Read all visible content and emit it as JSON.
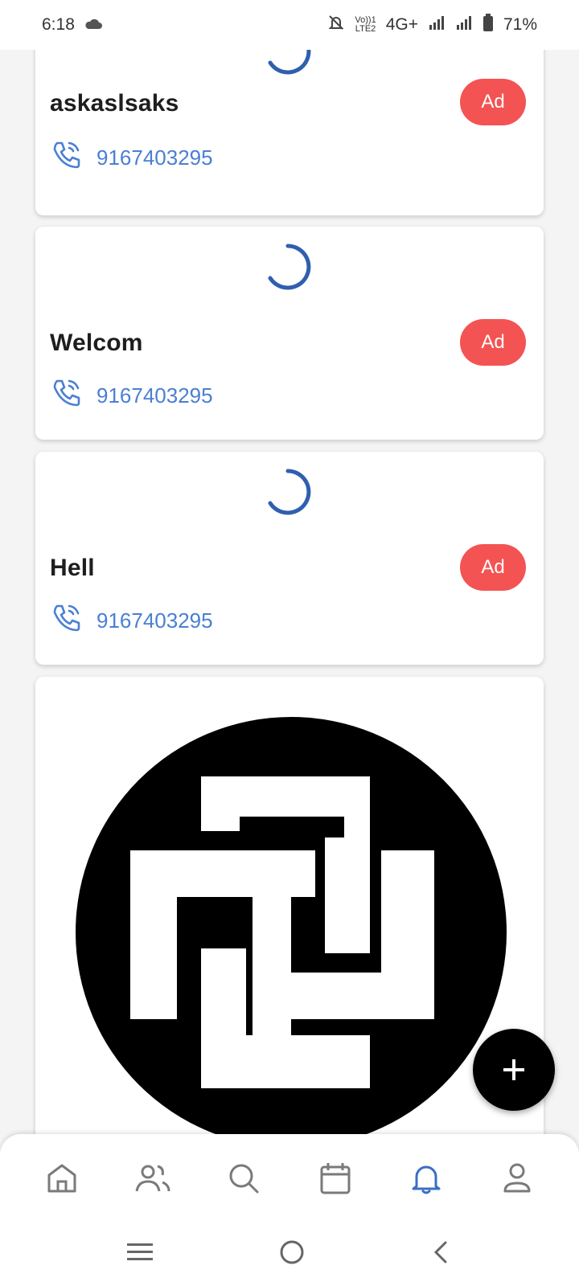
{
  "status_bar": {
    "time": "6:18",
    "lte_top": "Vo))1",
    "lte_bottom": "LTE2",
    "network": "4G+",
    "battery": "71%"
  },
  "cards": [
    {
      "title": "askaslsaks",
      "ad_label": "Ad",
      "phone": "9167403295"
    },
    {
      "title": "Welcom",
      "ad_label": "Ad",
      "phone": "9167403295"
    },
    {
      "title": "Hell",
      "ad_label": "Ad",
      "phone": "9167403295"
    }
  ],
  "fab": {
    "icon": "plus-icon"
  },
  "bottom_nav": {
    "items": [
      {
        "name": "home",
        "icon": "home-icon"
      },
      {
        "name": "people",
        "icon": "people-icon"
      },
      {
        "name": "search",
        "icon": "search-icon"
      },
      {
        "name": "calendar",
        "icon": "calendar-icon"
      },
      {
        "name": "notifications",
        "icon": "bell-icon",
        "active": true
      },
      {
        "name": "profile",
        "icon": "user-icon"
      }
    ],
    "active_color": "#3a6fc4",
    "inactive_color": "#7a7a7a"
  },
  "colors": {
    "accent_blue": "#4a7fd3",
    "ad_red": "#f45353",
    "spinner_blue": "#2f5fae"
  }
}
